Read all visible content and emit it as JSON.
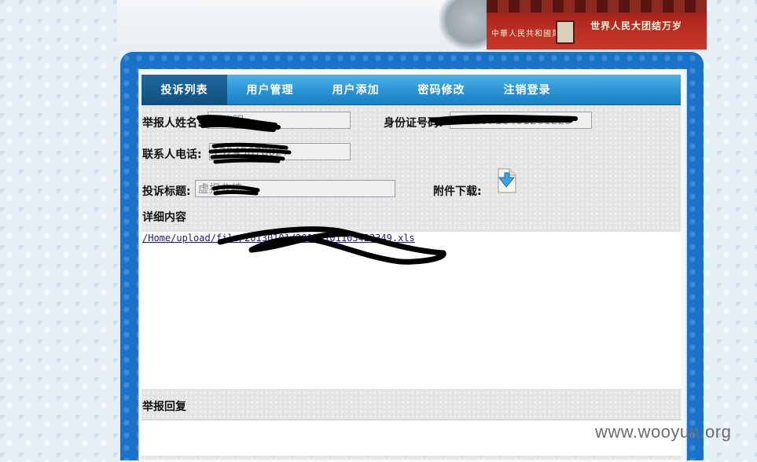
{
  "banner": {
    "slogan_left": "中華人民共和國萬歲",
    "slogan_right": "世界人民大团结万岁"
  },
  "tabs": [
    {
      "label": "投诉列表",
      "active": true
    },
    {
      "label": "用户管理",
      "active": false
    },
    {
      "label": "用户添加",
      "active": false
    },
    {
      "label": "密码修改",
      "active": false
    },
    {
      "label": "注销登录",
      "active": false
    }
  ],
  "form": {
    "reporter_name_label": "举报人姓名:",
    "reporter_name_value": "张晓明",
    "id_number_label": "身份证号码:",
    "id_number_value": "43223716401261225",
    "phone_label": "联系人电话:",
    "phone_value": "13245678027",
    "title_label": "投诉标题:",
    "title_value": "虚报业绩",
    "attachment_label": "附件下载:",
    "detail_label": "详细内容",
    "attachment_link": "/Home/upload/file/20130101/20130101103423349.xls",
    "reply_label": "举报回复"
  },
  "watermark": "www.wooyun.org",
  "colors": {
    "tab_active": "#0f4f7f",
    "tab_bar": "#2a93d6",
    "frame": "#1a73c8"
  }
}
